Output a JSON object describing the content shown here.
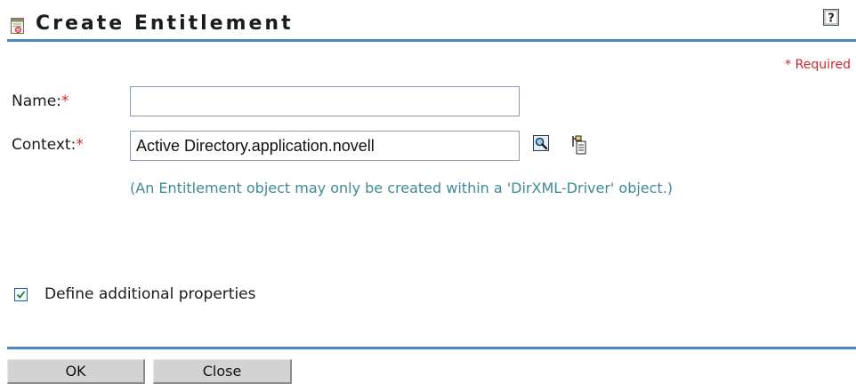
{
  "header": {
    "title": "Create Entitlement",
    "title_icon": "entitlement-icon",
    "help_icon": "help-icon",
    "accent_color": "#4a86c0"
  },
  "form": {
    "required_note": "* Required",
    "name": {
      "label": "Name:",
      "required_mark": "*",
      "value": ""
    },
    "context": {
      "label": "Context:",
      "required_mark": "*",
      "value": "Active Directory.application.novell",
      "hint": "(An Entitlement object may only be created within a 'DirXML-Driver' object.)",
      "search_icon": "magnifier-icon",
      "browse_icon": "object-browser-icon"
    },
    "additional_properties": {
      "label": "Define additional properties",
      "checked": true
    }
  },
  "buttons": {
    "ok": "OK",
    "close": "Close"
  },
  "colors": {
    "required": "#cc2a2a",
    "hint": "#3f8a96",
    "rule": "#4a86c0"
  }
}
